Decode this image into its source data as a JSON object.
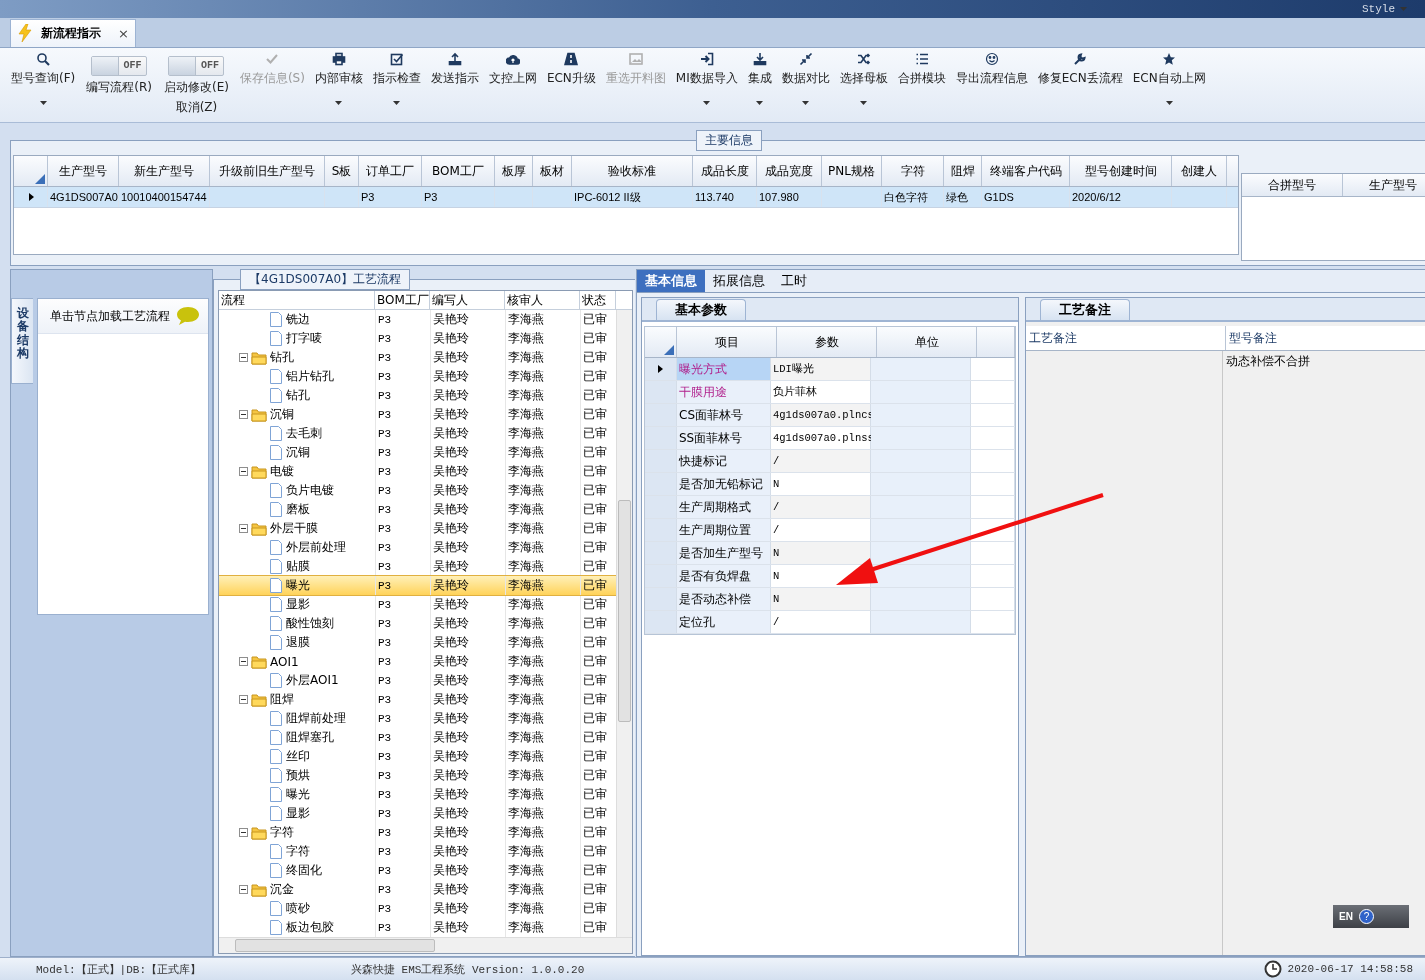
{
  "top_bar": {
    "style_menu": "Style"
  },
  "document_tab": {
    "title": "新流程指示",
    "close": "×"
  },
  "toolbar": [
    {
      "kind": "button",
      "label": "型号查询(F)",
      "dropdown": true,
      "disabled": false
    },
    {
      "kind": "toggle",
      "switch": "OFF",
      "on": false,
      "label": "编写流程(R)"
    },
    {
      "kind": "toggle",
      "switch": "OFF",
      "on": false,
      "label": "启动修改(E)",
      "label2": "取消(Z)"
    },
    {
      "kind": "button",
      "label": "保存信息(S)",
      "dropdown": false,
      "disabled": true
    },
    {
      "kind": "button",
      "label": "内部审核",
      "dropdown": true,
      "disabled": false
    },
    {
      "kind": "button",
      "label": "指示检查",
      "dropdown": true,
      "disabled": false
    },
    {
      "kind": "button",
      "label": "发送指示",
      "dropdown": false,
      "disabled": false
    },
    {
      "kind": "button",
      "label": "文控上网",
      "dropdown": false,
      "disabled": false
    },
    {
      "kind": "button",
      "label": "ECN升级",
      "dropdown": false,
      "disabled": false
    },
    {
      "kind": "button",
      "label": "重选开料图",
      "dropdown": false,
      "disabled": true
    },
    {
      "kind": "button",
      "label": "MI数据导入",
      "dropdown": true,
      "disabled": false
    },
    {
      "kind": "button",
      "label": "集成",
      "dropdown": true,
      "disabled": false
    },
    {
      "kind": "button",
      "label": "数据对比",
      "dropdown": true,
      "disabled": false
    },
    {
      "kind": "button",
      "label": "选择母板",
      "dropdown": true,
      "disabled": false
    },
    {
      "kind": "button",
      "label": "合拼模块",
      "dropdown": false,
      "disabled": false
    },
    {
      "kind": "button",
      "label": "导出流程信息",
      "dropdown": false,
      "disabled": false
    },
    {
      "kind": "button",
      "label": "修复ECN丢流程",
      "dropdown": false,
      "disabled": false
    },
    {
      "kind": "button",
      "label": "ECN自动上网",
      "dropdown": true,
      "disabled": false
    }
  ],
  "main_info": {
    "title": "主要信息",
    "row_selected": true,
    "columns": [
      {
        "header": "生产型号",
        "value": "4G1DS007A0"
      },
      {
        "header": "新生产型号",
        "value": "10010400154744"
      },
      {
        "header": "升级前旧生产型号"
      },
      {
        "header": "S板"
      },
      {
        "header": "订单工厂",
        "value": "P3"
      },
      {
        "header": "BOM工厂",
        "value": "P3"
      },
      {
        "header": "板厚"
      },
      {
        "header": "板材"
      },
      {
        "header": "验收标准",
        "value": "IPC-6012 II级"
      },
      {
        "header": "成品长度",
        "value": "113.740"
      },
      {
        "header": "成品宽度",
        "value": "107.980"
      },
      {
        "header": "PNL规格"
      },
      {
        "header": "字符",
        "value": "白色字符"
      },
      {
        "header": "阻焊",
        "value": "绿色"
      },
      {
        "header": "终端客户代码",
        "value": "G1DS"
      },
      {
        "header": "型号创建时间",
        "value": "2020/6/12"
      },
      {
        "header": "创建人"
      }
    ],
    "side_columns": [
      "合拼型号",
      "生产型号"
    ]
  },
  "left_panel": {
    "vertical_tab": "设备结构",
    "hint": "单击节点加载工艺流程"
  },
  "process_flow": {
    "title": "【4G1DS007A0】工艺流程",
    "columns": [
      "流程",
      "BOM工厂",
      "编写人",
      "核审人",
      "状态"
    ],
    "tree": [
      {
        "children": [
          {
            "name": "铣边",
            "bom": "P3",
            "writer": "吴艳玲",
            "reviewer": "李海燕",
            "status": "已审",
            "selected": false
          },
          {
            "name": "打字唛",
            "bom": "P3",
            "writer": "吴艳玲",
            "reviewer": "李海燕",
            "status": "已审",
            "selected": false
          }
        ]
      },
      {
        "name": "钻孔",
        "bom": "P3",
        "writer": "吴艳玲",
        "reviewer": "李海燕",
        "status": "已审",
        "selected": false,
        "expanded": true,
        "children": [
          {
            "name": "铝片钻孔",
            "bom": "P3",
            "writer": "吴艳玲",
            "reviewer": "李海燕",
            "status": "已审",
            "selected": false
          },
          {
            "name": "钻孔",
            "bom": "P3",
            "writer": "吴艳玲",
            "reviewer": "李海燕",
            "status": "已审",
            "selected": false
          }
        ]
      },
      {
        "name": "沉铜",
        "bom": "P3",
        "writer": "吴艳玲",
        "reviewer": "李海燕",
        "status": "已审",
        "selected": false,
        "expanded": true,
        "children": [
          {
            "name": "去毛刺",
            "bom": "P3",
            "writer": "吴艳玲",
            "reviewer": "李海燕",
            "status": "已审",
            "selected": false
          },
          {
            "name": "沉铜",
            "bom": "P3",
            "writer": "吴艳玲",
            "reviewer": "李海燕",
            "status": "已审",
            "selected": false
          }
        ]
      },
      {
        "name": "电镀",
        "bom": "P3",
        "writer": "吴艳玲",
        "reviewer": "李海燕",
        "status": "已审",
        "selected": false,
        "expanded": true,
        "children": [
          {
            "name": "负片电镀",
            "bom": "P3",
            "writer": "吴艳玲",
            "reviewer": "李海燕",
            "status": "已审",
            "selected": false
          },
          {
            "name": "磨板",
            "bom": "P3",
            "writer": "吴艳玲",
            "reviewer": "李海燕",
            "status": "已审",
            "selected": false
          }
        ]
      },
      {
        "name": "外层干膜",
        "bom": "P3",
        "writer": "吴艳玲",
        "reviewer": "李海燕",
        "status": "已审",
        "selected": false,
        "expanded": true,
        "children": [
          {
            "name": "外层前处理",
            "bom": "P3",
            "writer": "吴艳玲",
            "reviewer": "李海燕",
            "status": "已审",
            "selected": false
          },
          {
            "name": "贴膜",
            "bom": "P3",
            "writer": "吴艳玲",
            "reviewer": "李海燕",
            "status": "已审",
            "selected": false
          },
          {
            "name": "曝光",
            "bom": "P3",
            "writer": "吴艳玲",
            "reviewer": "李海燕",
            "status": "已审",
            "selected": true
          },
          {
            "name": "显影",
            "bom": "P3",
            "writer": "吴艳玲",
            "reviewer": "李海燕",
            "status": "已审",
            "selected": false
          },
          {
            "name": "酸性蚀刻",
            "bom": "P3",
            "writer": "吴艳玲",
            "reviewer": "李海燕",
            "status": "已审",
            "selected": false
          },
          {
            "name": "退膜",
            "bom": "P3",
            "writer": "吴艳玲",
            "reviewer": "李海燕",
            "status": "已审",
            "selected": false
          }
        ]
      },
      {
        "name": "AOI1",
        "bom": "P3",
        "writer": "吴艳玲",
        "reviewer": "李海燕",
        "status": "已审",
        "selected": false,
        "expanded": true,
        "children": [
          {
            "name": "外层AOI1",
            "bom": "P3",
            "writer": "吴艳玲",
            "reviewer": "李海燕",
            "status": "已审",
            "selected": false
          }
        ]
      },
      {
        "name": "阻焊",
        "bom": "P3",
        "writer": "吴艳玲",
        "reviewer": "李海燕",
        "status": "已审",
        "selected": false,
        "expanded": true,
        "children": [
          {
            "name": "阻焊前处理",
            "bom": "P3",
            "writer": "吴艳玲",
            "reviewer": "李海燕",
            "status": "已审",
            "selected": false
          },
          {
            "name": "阻焊塞孔",
            "bom": "P3",
            "writer": "吴艳玲",
            "reviewer": "李海燕",
            "status": "已审",
            "selected": false
          },
          {
            "name": "丝印",
            "bom": "P3",
            "writer": "吴艳玲",
            "reviewer": "李海燕",
            "status": "已审",
            "selected": false
          },
          {
            "name": "预烘",
            "bom": "P3",
            "writer": "吴艳玲",
            "reviewer": "李海燕",
            "status": "已审",
            "selected": false
          },
          {
            "name": "曝光",
            "bom": "P3",
            "writer": "吴艳玲",
            "reviewer": "李海燕",
            "status": "已审",
            "selected": false
          },
          {
            "name": "显影",
            "bom": "P3",
            "writer": "吴艳玲",
            "reviewer": "李海燕",
            "status": "已审",
            "selected": false
          }
        ]
      },
      {
        "name": "字符",
        "bom": "P3",
        "writer": "吴艳玲",
        "reviewer": "李海燕",
        "status": "已审",
        "selected": false,
        "expanded": true,
        "children": [
          {
            "name": "字符",
            "bom": "P3",
            "writer": "吴艳玲",
            "reviewer": "李海燕",
            "status": "已审",
            "selected": false
          },
          {
            "name": "终固化",
            "bom": "P3",
            "writer": "吴艳玲",
            "reviewer": "李海燕",
            "status": "已审",
            "selected": false
          }
        ]
      },
      {
        "name": "沉金",
        "bom": "P3",
        "writer": "吴艳玲",
        "reviewer": "李海燕",
        "status": "已审",
        "selected": false,
        "expanded": true,
        "children": [
          {
            "name": "喷砂",
            "bom": "P3",
            "writer": "吴艳玲",
            "reviewer": "李海燕",
            "status": "已审",
            "selected": false
          },
          {
            "name": "板边包胶",
            "bom": "P3",
            "writer": "吴艳玲",
            "reviewer": "李海燕",
            "status": "已审",
            "selected": false
          }
        ]
      }
    ]
  },
  "detail_tabs": [
    {
      "label": "基本信息",
      "selected": true
    },
    {
      "label": "拓展信息",
      "selected": false
    },
    {
      "label": "工时",
      "selected": false
    }
  ],
  "basic_params": {
    "tab": "基本参数",
    "columns": [
      "项目",
      "参数",
      "单位"
    ],
    "rows": [
      {
        "item": "曝光方式",
        "value": "LDI曝光",
        "kind": "key",
        "selected": true
      },
      {
        "item": "干膜用途",
        "value": "负片菲林",
        "kind": "key",
        "selected": false
      },
      {
        "item": "CS面菲林号",
        "value": "4g1ds007a0.plncs",
        "kind": "plain",
        "selected": false
      },
      {
        "item": "SS面菲林号",
        "value": "4g1ds007a0.plnss",
        "kind": "plain",
        "selected": false
      },
      {
        "item": "快捷标记",
        "value": "/",
        "kind": "plain",
        "selected": false
      },
      {
        "item": "是否加无铅标记",
        "value": "N",
        "kind": "plain",
        "selected": false
      },
      {
        "item": "生产周期格式",
        "value": "/",
        "kind": "plain",
        "selected": false
      },
      {
        "item": "生产周期位置",
        "value": "/",
        "kind": "plain",
        "selected": false
      },
      {
        "item": "是否加生产型号",
        "value": "N",
        "kind": "plain",
        "selected": false
      },
      {
        "item": "是否有负焊盘",
        "value": "N",
        "kind": "plain",
        "selected": false
      },
      {
        "item": "是否动态补偿",
        "value": "N",
        "kind": "plain",
        "selected": false
      },
      {
        "item": "定位孔",
        "value": "/",
        "kind": "plain",
        "selected": false
      }
    ]
  },
  "remarks": {
    "tab": "工艺备注",
    "columns": [
      "工艺备注",
      "型号备注"
    ],
    "model_remark": "动态补偿不合拼"
  },
  "language_bar": {
    "label": "EN",
    "help": "?"
  },
  "status_bar": {
    "model": "Model:【正式】|DB:【正式库】",
    "version": "兴森快捷 EMS工程系统 Version: 1.0.0.20",
    "datetime": "2020-06-17 14:58:58"
  }
}
